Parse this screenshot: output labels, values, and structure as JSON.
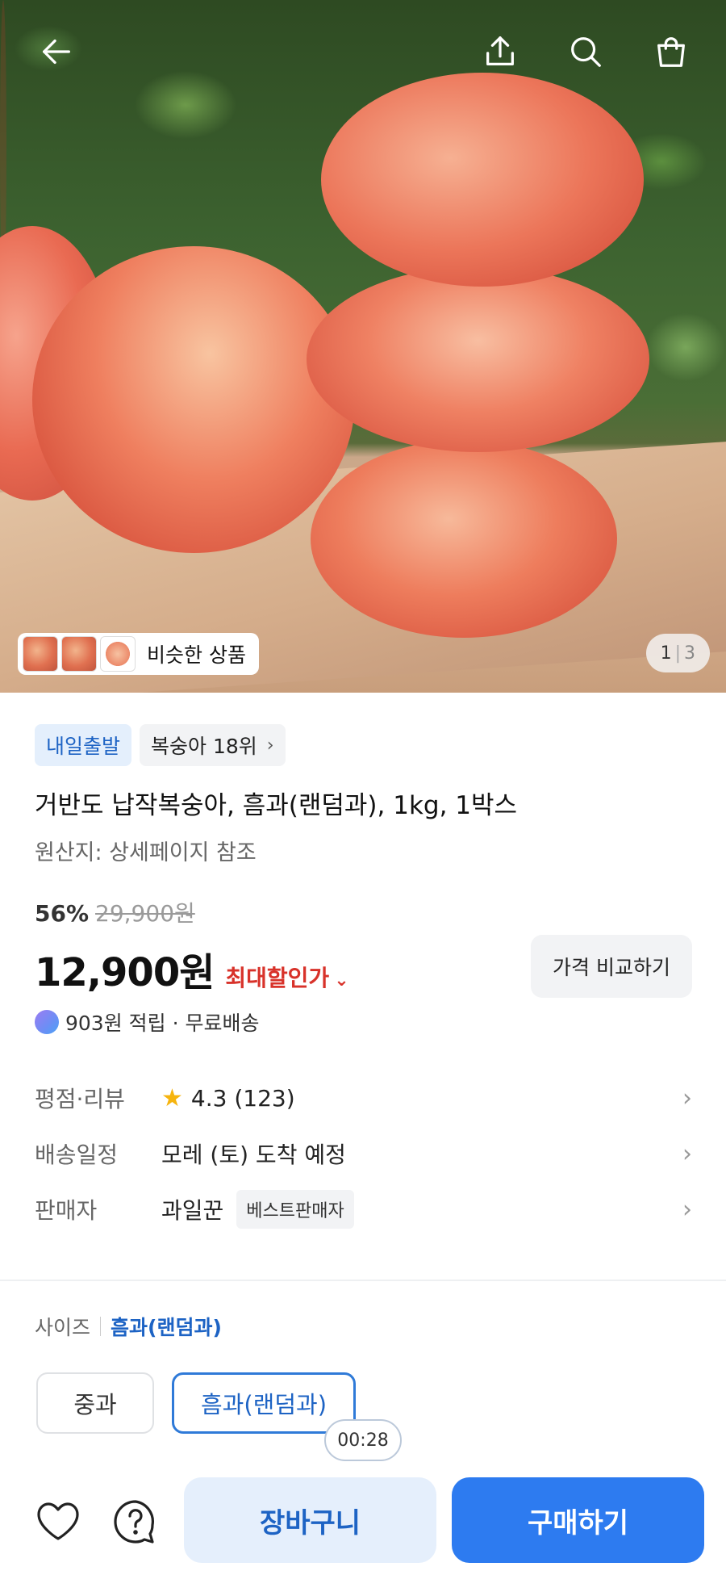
{
  "hero": {
    "similar_label": "비슷한 상품",
    "image_index": "1",
    "image_total": "3",
    "icons": [
      "back-arrow-icon",
      "share-icon",
      "search-icon",
      "cart-icon"
    ]
  },
  "badges": {
    "delivery": "내일출발",
    "rank": "복숭아 18위"
  },
  "product": {
    "title": "거반도 납작복숭아, 흠과(랜덤과), 1kg, 1박스",
    "origin": "원산지: 상세페이지 참조",
    "discount_pct": "56%",
    "original_price": "29,900원",
    "price": "12,900원",
    "best_price_label": "최대할인가",
    "compare_button": "가격 비교하기",
    "points": "903원 적립 · 무료배송"
  },
  "info": {
    "rating_label": "평점·리뷰",
    "rating_value": "4.3 (123)",
    "shipping_label": "배송일정",
    "shipping_value": "모레 (토) 도착 예정",
    "seller_label": "판매자",
    "seller_value": "과일꾼",
    "seller_tag": "베스트판매자"
  },
  "options": {
    "size_label": "사이즈",
    "selected": "흠과(랜덤과)",
    "items": [
      "중과",
      "흠과(랜덤과)"
    ],
    "timer": "00:28"
  },
  "bottom": {
    "cart_label": "장바구니",
    "buy_label": "구매하기"
  },
  "colors": {
    "accent_blue": "#2d7bf0",
    "price_red": "#d8322a",
    "badge_blue_bg": "#e4effc"
  }
}
